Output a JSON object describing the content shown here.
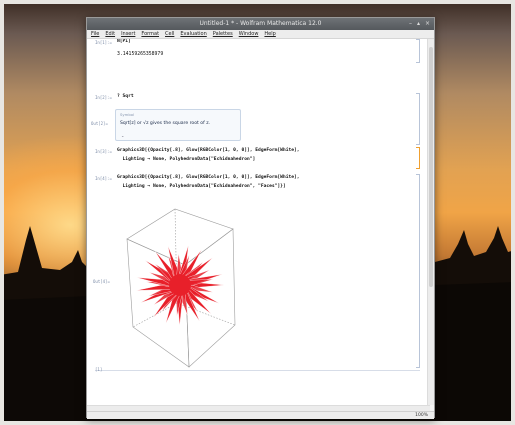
{
  "window": {
    "title": "Untitled-1 * - Wolfram Mathematica 12.0",
    "controls": [
      "–",
      "▴",
      "×"
    ]
  },
  "menu": [
    "File",
    "Edit",
    "Insert",
    "Format",
    "Cell",
    "Evaluation",
    "Palettes",
    "Window",
    "Help"
  ],
  "cells": [
    {
      "label": "In[1]:=",
      "code": "N[Pi]"
    },
    {
      "label": "Out[1]=",
      "output": "3.14159265358979"
    },
    {
      "label": "In[2]:=",
      "code": "? Sqrt"
    },
    {
      "label": "Out[2]=",
      "info_tag": "Symbol",
      "info_text": "Sqrt[z] or √z gives the square root of z."
    },
    {
      "label": "In[3]:=",
      "code_lines": [
        "Graphics3D[{Opacity[.8], Glow[RGBColor[1, 0, 0]], EdgeForm[White],",
        "  Lighting → None, PolyhedronData[\"Echidnahedron\"]"
      ]
    },
    {
      "label": "In[4]:=",
      "code_lines": [
        "Graphics3D[{Opacity[.8], Glow[RGBColor[1, 0, 0]], EdgeForm[White],",
        "  Lighting → None, PolyhedronData[\"Echidnahedron\", \"Faces\"]}]"
      ]
    },
    {
      "label": "Out[4]="
    }
  ],
  "status": {
    "zoom": "100%"
  },
  "colors": {
    "glow": "#e8202a",
    "bracket_selected": "#f0a030"
  },
  "icons": {
    "expand": "chevron-down-icon"
  }
}
